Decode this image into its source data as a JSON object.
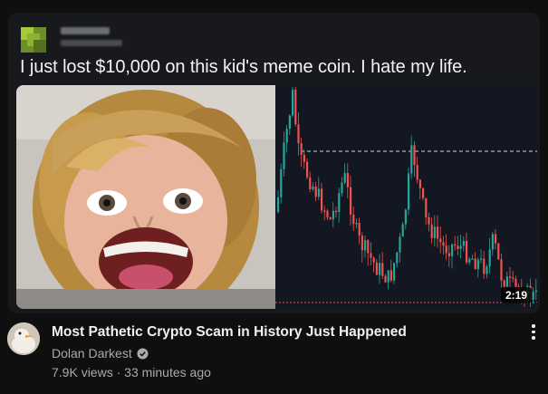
{
  "post": {
    "text": "I just lost $10,000 on this kid's meme coin. I hate my life."
  },
  "video": {
    "duration": "2:19",
    "title": "Most Pathetic Crypto Scam in History Just Happened",
    "channel": "Dolan Darkest",
    "views": "7.9K views",
    "separator": " · ",
    "age": "33 minutes ago"
  },
  "icons": {
    "verified": "verified-check-icon",
    "more": "more-vert-icon"
  },
  "colors": {
    "background": "#0f0f0f",
    "card": "#18191c",
    "candle_up": "#26a69a",
    "candle_down": "#ef5350"
  }
}
